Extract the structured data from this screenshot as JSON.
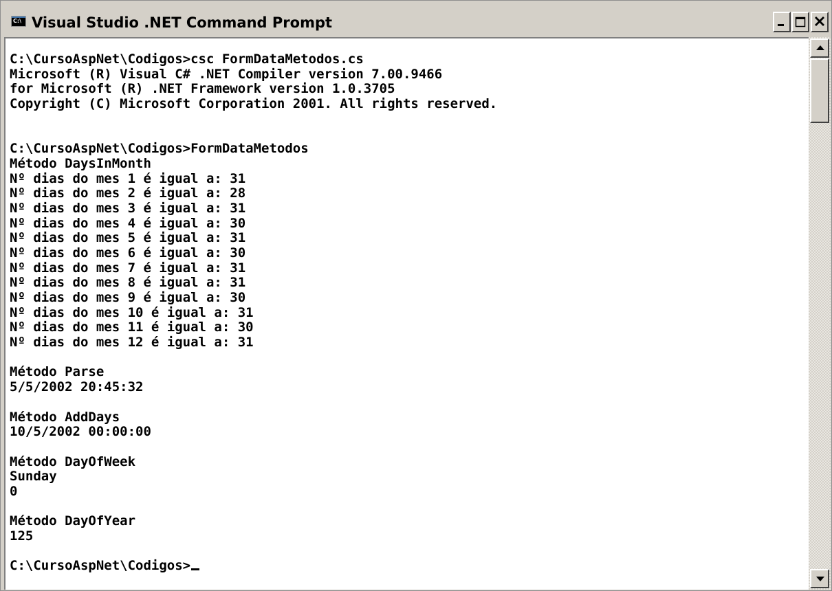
{
  "window": {
    "title": "Visual Studio .NET Command Prompt",
    "icon": "console-icon",
    "icon_text": "C:\\",
    "caption_buttons": [
      "minimize-icon",
      "maximize-icon",
      "close-icon"
    ]
  },
  "console": {
    "lines": [
      "C:\\CursoAspNet\\Codigos>csc FormDataMetodos.cs",
      "Microsoft (R) Visual C# .NET Compiler version 7.00.9466",
      "for Microsoft (R) .NET Framework version 1.0.3705",
      "Copyright (C) Microsoft Corporation 2001. All rights reserved.",
      "",
      "",
      "C:\\CursoAspNet\\Codigos>FormDataMetodos",
      "Método DaysInMonth",
      "Nº dias do mes 1 é igual a: 31",
      "Nº dias do mes 2 é igual a: 28",
      "Nº dias do mes 3 é igual a: 31",
      "Nº dias do mes 4 é igual a: 30",
      "Nº dias do mes 5 é igual a: 31",
      "Nº dias do mes 6 é igual a: 30",
      "Nº dias do mes 7 é igual a: 31",
      "Nº dias do mes 8 é igual a: 31",
      "Nº dias do mes 9 é igual a: 30",
      "Nº dias do mes 10 é igual a: 31",
      "Nº dias do mes 11 é igual a: 30",
      "Nº dias do mes 12 é igual a: 31",
      "",
      "Método Parse",
      "5/5/2002 20:45:32",
      "",
      "Método AddDays",
      "10/5/2002 00:00:00",
      "",
      "Método DayOfWeek",
      "Sunday",
      "0",
      "",
      "Método DayOfYear",
      "125",
      "",
      "C:\\CursoAspNet\\Codigos>"
    ]
  },
  "scrollbar": {
    "up_icon": "scroll-up-arrow-icon",
    "down_icon": "scroll-down-arrow-icon"
  },
  "colors": {
    "chrome": "#d4d0c8",
    "console_bg": "#ffffff",
    "console_text": "#000000"
  }
}
